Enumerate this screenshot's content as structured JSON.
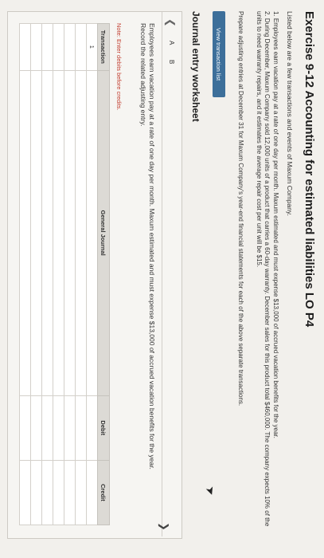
{
  "header": {
    "title": "Exercise 9-12 Accounting for estimated liabilities LO P4",
    "intro": "Listed below are a few transactions and events of Maxum Company."
  },
  "transactions": [
    "1. Employees earn vacation pay at a rate of one day per month. Maxum estimated and must expense $13,000 of accrued vacation benefits for the year.",
    "2. During December, Maxum Company sold 12,000 units of a product that carries a 60-day warranty. December sales for this product total $460,000. The company expects 10% of the units to need warranty repairs, and it estimates the average repair cost per unit will be $15."
  ],
  "instructions": "Prepare adjusting entries at December 31 for Maxum Company's year-end financial statements for each of the above separate transactions.",
  "buttons": {
    "view_transaction_list": "View transaction list"
  },
  "worksheet": {
    "title": "Journal entry worksheet",
    "tabs": [
      {
        "label": "A"
      },
      {
        "label": "B"
      }
    ],
    "description": "Employees earn vacation pay at a rate of one day per month. Maxum estimated and must expense $13,000 of accrued vacation benefits for the year. Record the related adjusting entry.",
    "note": "Note: Enter debits before credits.",
    "table": {
      "headers": [
        "Transaction",
        "General Journal",
        "Debit",
        "Credit"
      ],
      "first_row_transaction": "1"
    }
  },
  "icons": {
    "prev": "chevron-left-icon",
    "next": "chevron-right-icon",
    "cursor": "mouse-pointer-icon"
  },
  "colors": {
    "button_bg": "#3d6f9a",
    "note_red": "#c0392b"
  }
}
